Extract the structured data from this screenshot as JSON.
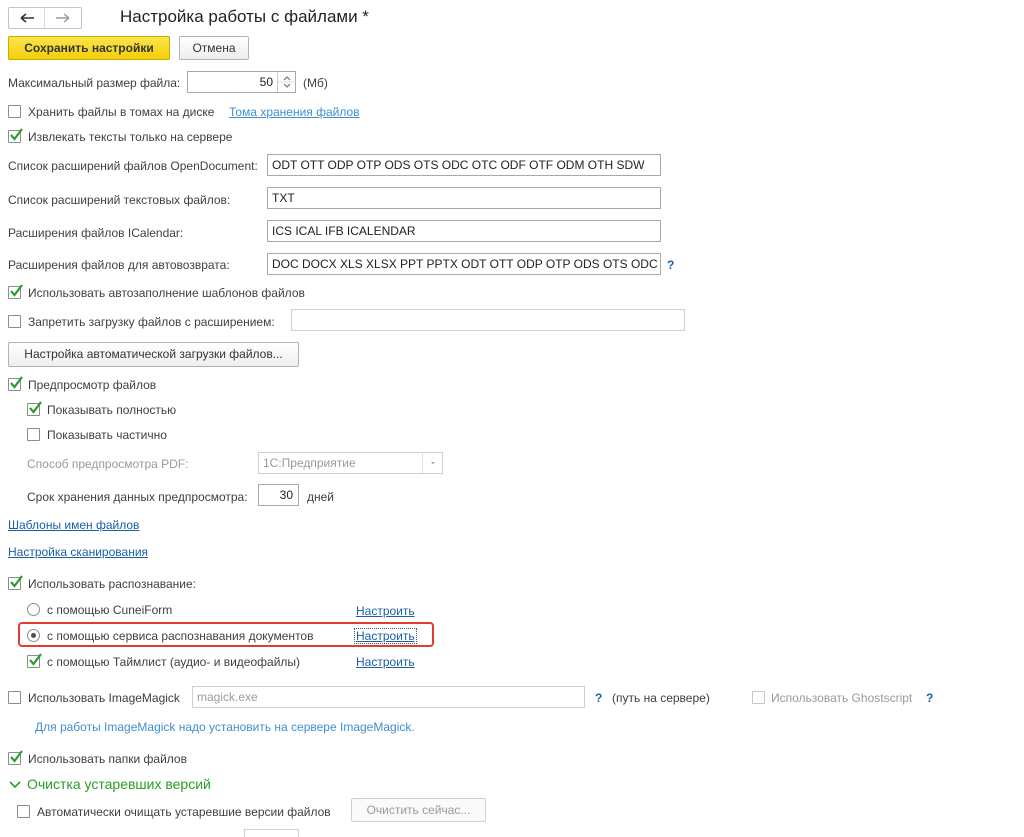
{
  "header": {
    "title": "Настройка работы с файлами *",
    "back_icon": "arrow-left-icon",
    "forward_icon": "arrow-right-icon"
  },
  "toolbar": {
    "save_label": "Сохранить настройки",
    "cancel_label": "Отмена"
  },
  "max_size": {
    "label": "Максимальный размер файла:",
    "value": "50",
    "unit": "(Мб)"
  },
  "store_volumes": {
    "label": "Хранить файлы в томах на диске",
    "checked": false,
    "link": "Тома хранения файлов"
  },
  "extract_texts": {
    "label": "Извлекать тексты только на сервере",
    "checked": true
  },
  "fields": {
    "opendoc": {
      "label": "Список расширений файлов OpenDocument:",
      "value": "ODT OTT ODP OTP ODS OTS ODC OTC ODF OTF ODM OTH SDW"
    },
    "text_ext": {
      "label": "Список расширений текстовых файлов:",
      "value": "TXT"
    },
    "icalendar": {
      "label": "Расширения файлов ICalendar:",
      "value": "ICS ICAL IFB ICALENDAR"
    },
    "autoreturn": {
      "label": "Расширения файлов для автовозврата:",
      "value": "DOC DOCX XLS XLSX PPT PPTX ODT OTT ODP OTP ODS OTS ODC",
      "help": "?"
    }
  },
  "autofill": {
    "label": "Использовать автозаполнение шаблонов файлов",
    "checked": true
  },
  "forbid_upload": {
    "label": "Запретить загрузку файлов с расширением:",
    "checked": false,
    "value": ""
  },
  "auto_upload_button": "Настройка автоматической загрузки файлов...",
  "preview": {
    "label": "Предпросмотр файлов",
    "checked": true,
    "show_full": {
      "label": "Показывать полностью",
      "checked": true
    },
    "show_partial": {
      "label": "Показывать частично",
      "checked": false
    },
    "pdf_method_label": "Способ предпросмотра PDF:",
    "pdf_method_value": "1С:Предприятие",
    "retention_label": "Срок хранения данных предпросмотра:",
    "retention_value": "30",
    "retention_unit": "дней"
  },
  "links": {
    "name_templates": "Шаблоны имен файлов",
    "scan_settings": "Настройка сканирования"
  },
  "recognition": {
    "label": "Использовать распознавание:",
    "checked": true,
    "cuneiform": {
      "label": "с помощью CuneiForm",
      "selected": false,
      "link": "Настроить"
    },
    "service": {
      "label": "с помощью сервиса распознавания документов",
      "selected": true,
      "link": "Настроить"
    },
    "timelist": {
      "label": "с помощью Таймлист (аудио- и видеофайлы)",
      "checked": true,
      "link": "Настроить"
    },
    "highlight_color": "#e03c31"
  },
  "imagemagick": {
    "label": "Использовать ImageMagick",
    "checked": false,
    "placeholder": "magick.exe",
    "help": "?",
    "server_note": "(путь на сервере)",
    "ghostscript_label": "Использовать Ghostscript",
    "ghostscript_help": "?",
    "hint": "Для работы ImageMagick надо установить на сервере ImageMagick."
  },
  "folders": {
    "label": "Использовать папки файлов",
    "checked": true
  },
  "cleanup": {
    "section_title": "Очистка устаревших версий",
    "auto_label": "Автоматически очищать устаревшие версии файлов",
    "auto_checked": false,
    "clean_now": "Очистить сейчас..."
  },
  "colors": {
    "accent_green": "#2a9d2a",
    "link_blue": "#1a5fa8",
    "primary_yellow": "#f5d30f"
  }
}
